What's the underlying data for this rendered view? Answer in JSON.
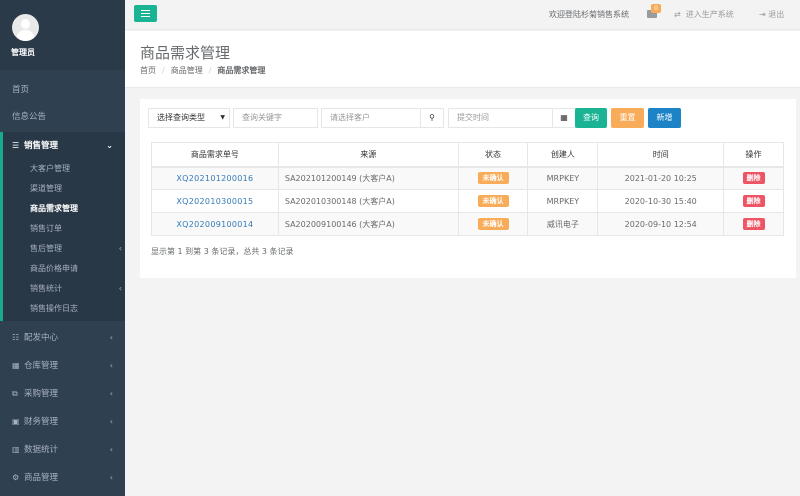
{
  "sidebar": {
    "profile_name": "管理员",
    "home": "首页",
    "notice": "信息公告",
    "sales_mgmt": "销售管理",
    "sales_sub": [
      {
        "label": "大客户管理",
        "arrow": ""
      },
      {
        "label": "渠道管理",
        "arrow": ""
      },
      {
        "label": "商品需求管理",
        "arrow": ""
      },
      {
        "label": "销售订单",
        "arrow": ""
      },
      {
        "label": "售后管理",
        "arrow": "‹"
      },
      {
        "label": "商品价格申请",
        "arrow": ""
      },
      {
        "label": "销售统计",
        "arrow": "‹"
      },
      {
        "label": "销售操作日志",
        "arrow": ""
      }
    ],
    "menus": [
      {
        "label": "配发中心",
        "icon": "list-icon"
      },
      {
        "label": "仓库管理",
        "icon": "warehouse-icon"
      },
      {
        "label": "采购管理",
        "icon": "purchase-icon"
      },
      {
        "label": "财务管理",
        "icon": "finance-icon"
      },
      {
        "label": "数据统计",
        "icon": "chart-icon"
      },
      {
        "label": "商品管理",
        "icon": "gears-icon"
      }
    ]
  },
  "topbar": {
    "welcome": "欢迎登陆杉菊销售系统",
    "mail_count": "0",
    "prod_system": "进入生产系统",
    "logout": "退出"
  },
  "heading": {
    "title": "商品需求管理",
    "breadcrumb": [
      "首页",
      "商品管理",
      "商品需求管理"
    ]
  },
  "toolbar": {
    "query_type": "选择查询类型",
    "keyword_placeholder": "查询关键字",
    "customer_placeholder": "请选择客户",
    "date_placeholder": "提交时间",
    "query": "查询",
    "reset": "重置",
    "add": "新增"
  },
  "table": {
    "headers": [
      "商品需求单号",
      "来源",
      "状态",
      "创建人",
      "时间",
      "操作"
    ],
    "rows": [
      {
        "id": "XQ202101200016",
        "source": "SA202101200149 (大客户A)",
        "status": "未确认",
        "creator": "MRPKEY",
        "time": "2021-01-20 10:25",
        "action": "删除"
      },
      {
        "id": "XQ202010300015",
        "source": "SA202010300148 (大客户A)",
        "status": "未确认",
        "creator": "MRPKEY",
        "time": "2020-10-30 15:40",
        "action": "删除"
      },
      {
        "id": "XQ202009100014",
        "source": "SA202009100146 (大客户A)",
        "status": "未确认",
        "creator": "威讯电子",
        "time": "2020-09-10 12:54",
        "action": "删除"
      }
    ]
  },
  "pagination": {
    "info": "显示第 1 到第 3 条记录，总共 3 条记录"
  },
  "colors": {
    "sidebar": "#2f4050",
    "accent": "#1ab394",
    "warning": "#f8ac59",
    "primary": "#1c84c6",
    "danger": "#ed5565"
  }
}
